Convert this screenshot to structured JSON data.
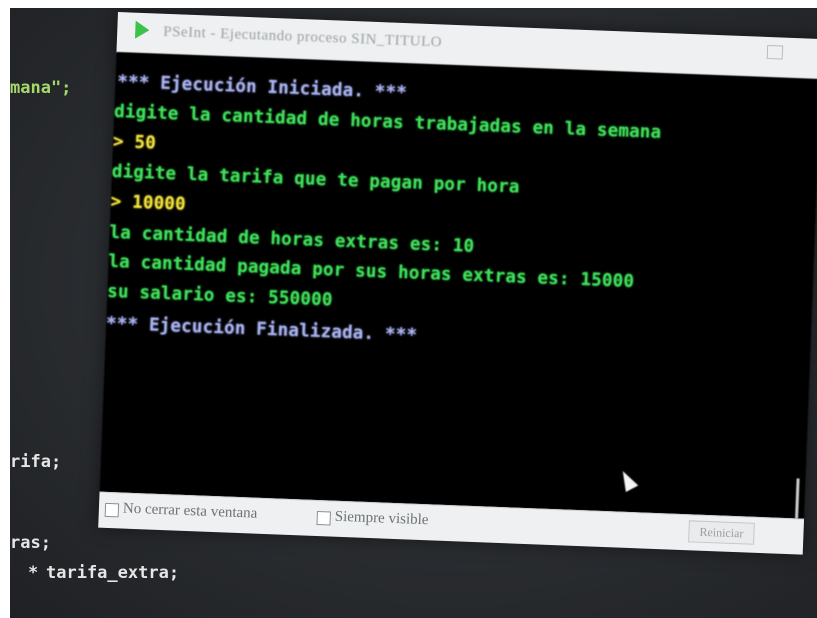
{
  "editor": {
    "fragment_top": "mana\";",
    "fragment_mid": "rifa;",
    "fragment_low": "ras;",
    "fragment_bottom_op": "*",
    "fragment_bottom": "tarifa_extra;"
  },
  "window": {
    "title": "PSeInt - Ejecutando proceso SIN_TITULO",
    "icon": "pseint-play-icon"
  },
  "console": {
    "lines": [
      {
        "text": "*** Ejecución Iniciada. ***",
        "kind": "system"
      },
      {
        "text": "digite la cantidad de horas trabajadas en la semana",
        "kind": "output"
      },
      {
        "text": "> 50",
        "kind": "input"
      },
      {
        "text": "digite la tarifa que te pagan por hora",
        "kind": "output"
      },
      {
        "text": "> 10000",
        "kind": "input"
      },
      {
        "text": "la cantidad de horas extras es: 10",
        "kind": "output"
      },
      {
        "text": "la cantidad pagada por sus horas extras es: 15000",
        "kind": "output"
      },
      {
        "text": "su salario es: 550000",
        "kind": "output"
      },
      {
        "text": "*** Ejecución Finalizada. ***",
        "kind": "system"
      }
    ]
  },
  "footer": {
    "keep_open_label": "No cerrar esta ventana",
    "always_visible_label": "Siempre visible",
    "restart_label": "Reiniciar"
  },
  "colors": {
    "system_text": "#a9b2f2",
    "output_text": "#3fe05a",
    "input_text": "#f2e33a",
    "console_background": "#000000"
  }
}
